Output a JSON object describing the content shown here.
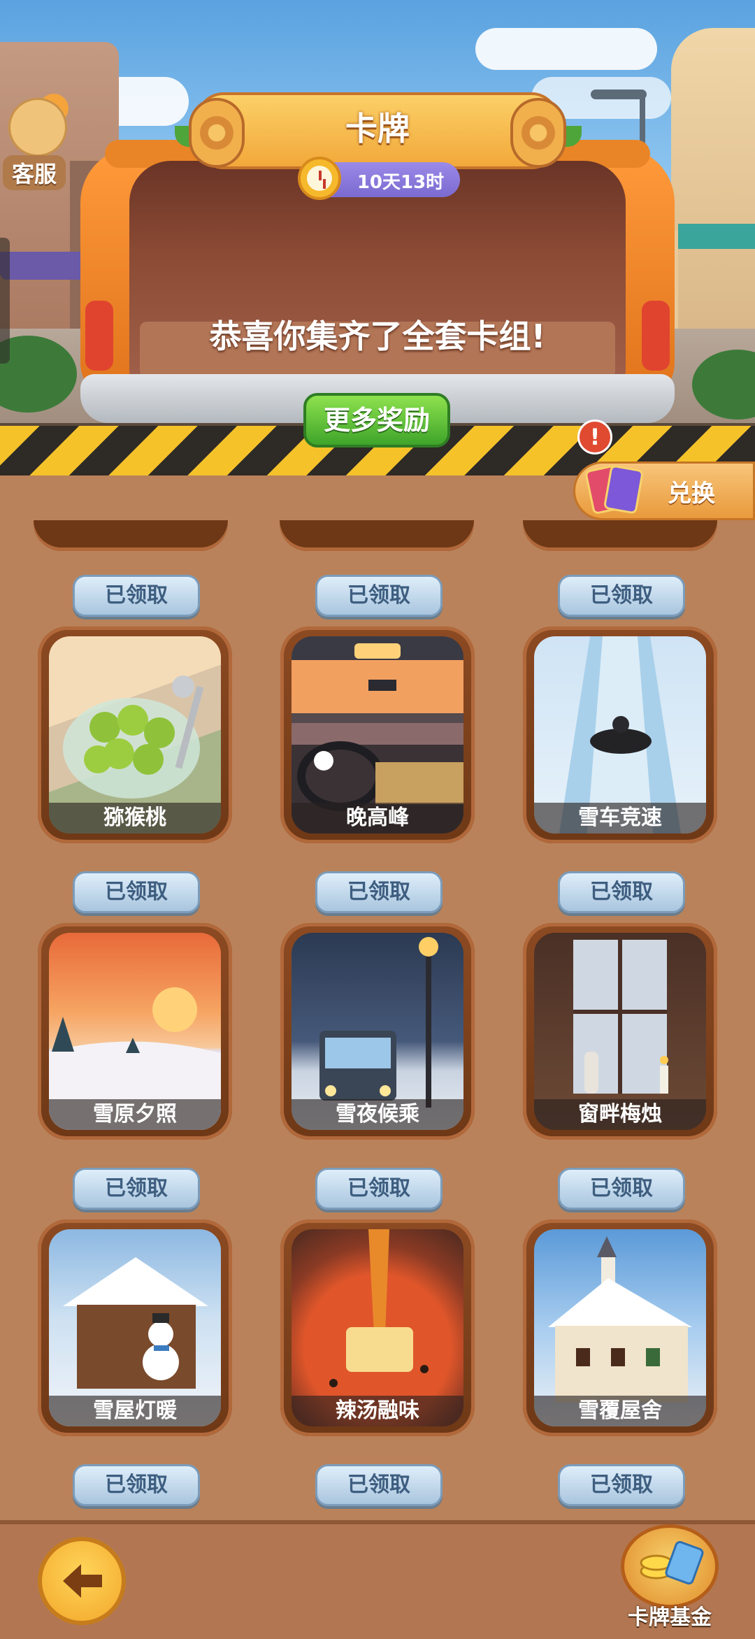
{
  "header": {
    "title": "卡牌",
    "countdown": "10天13时",
    "customer_service_label": "客服",
    "congrats_text": "恭喜你集齐了全套卡组!",
    "more_rewards_label": "更多奖励",
    "exchange_label": "兑换"
  },
  "cards": {
    "claimed_label": "已领取",
    "items": [
      {
        "name": "猕猴桃",
        "status": "已领取"
      },
      {
        "name": "晚高峰",
        "status": "已领取"
      },
      {
        "name": "雪车竞速",
        "status": "已领取"
      },
      {
        "name": "雪原夕照",
        "status": "已领取"
      },
      {
        "name": "雪夜候乘",
        "status": "已领取"
      },
      {
        "name": "窗畔梅烛",
        "status": "已领取"
      },
      {
        "name": "雪屋灯暖",
        "status": "已领取"
      },
      {
        "name": "辣汤融味",
        "status": "已领取"
      },
      {
        "name": "雪覆屋舍",
        "status": "已领取"
      }
    ]
  },
  "footer": {
    "back_icon": "arrow-left-icon",
    "fund_label": "卡牌基金"
  },
  "colors": {
    "accent_green": "#3ea42a",
    "claimed_button": "#a9c5de",
    "timer_purple": "#7b6ad0",
    "background": "#b9825a"
  }
}
